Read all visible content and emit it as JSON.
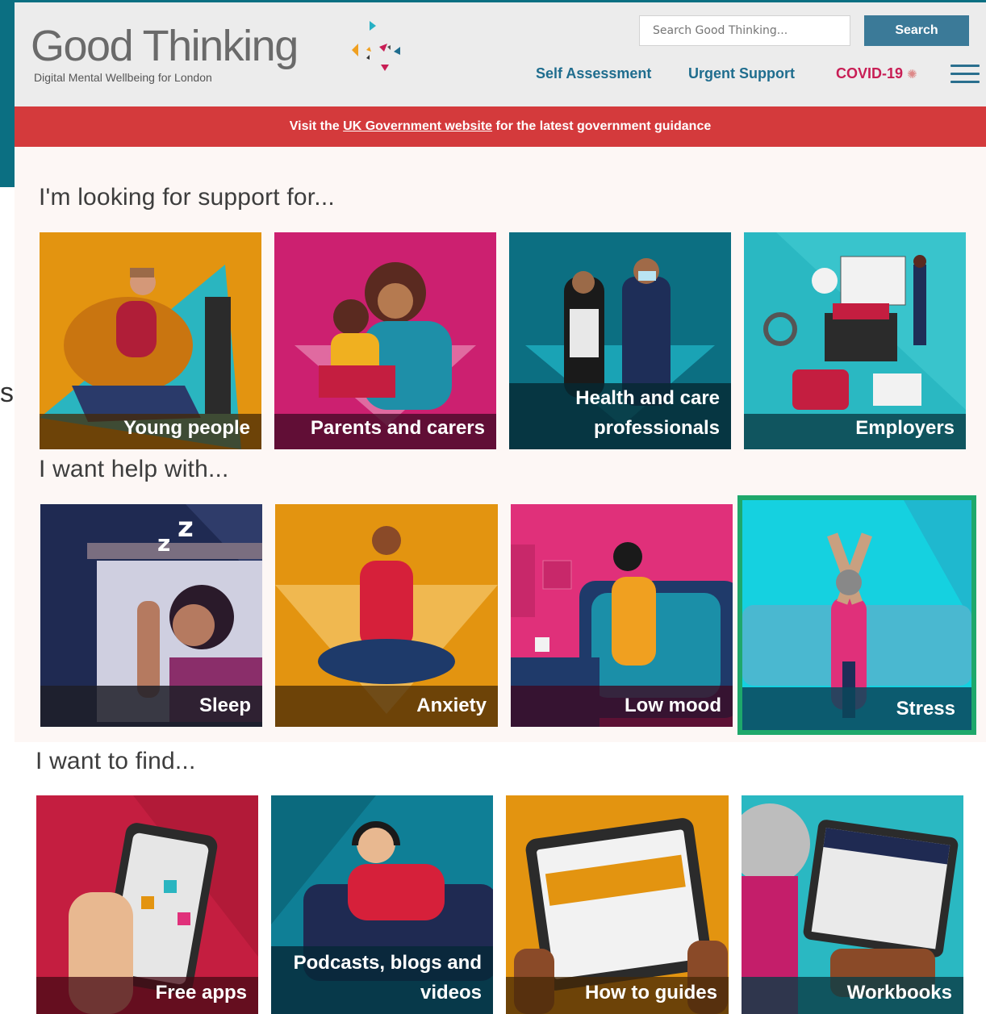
{
  "header": {
    "logo_text": "Good Thinking",
    "logo_tagline": "Digital Mental Wellbeing for London",
    "search_placeholder": "Search Good Thinking...",
    "search_button": "Search",
    "nav": {
      "self_assessment": "Self Assessment",
      "urgent_support": "Urgent Support",
      "covid": "COVID-19"
    }
  },
  "banner": {
    "prefix": "Visit the",
    "link": "UK Government website",
    "suffix": "for the latest government guidance"
  },
  "sections": {
    "support_title": "I'm looking for support for...",
    "help_title": "I want help with...",
    "find_title": "I want to find..."
  },
  "support_tiles": [
    "Young people",
    "Parents and carers",
    "Health and care professionals",
    "Employers"
  ],
  "help_tiles": [
    "Sleep",
    "Anxiety",
    "Low mood",
    "Stress"
  ],
  "find_tiles": [
    "Free apps",
    "Podcasts, blogs and videos",
    "How to guides",
    "Workbooks"
  ],
  "colors": {
    "header_bg": "#ececec",
    "banner_red": "#d43a3c",
    "link_blue": "#1f6d8e",
    "covid_pink": "#c81e55",
    "selected_green": "#1ea86b"
  }
}
